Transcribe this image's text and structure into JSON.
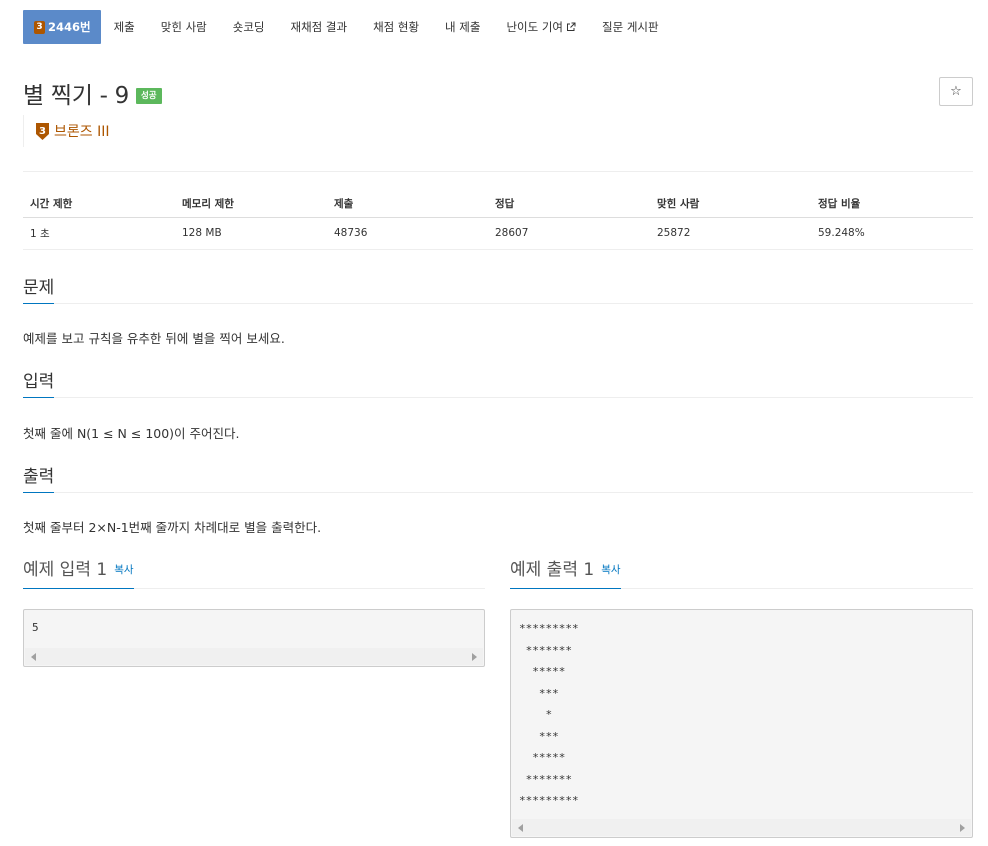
{
  "nav": {
    "problem_tab": {
      "tier_level": "3",
      "label": "2446번"
    },
    "items": [
      {
        "label": "제출"
      },
      {
        "label": "맞힌 사람"
      },
      {
        "label": "숏코딩"
      },
      {
        "label": "재채점 결과"
      },
      {
        "label": "채점 현황"
      },
      {
        "label": "내 제출"
      },
      {
        "label": "난이도 기여"
      },
      {
        "label": "질문 게시판"
      }
    ]
  },
  "problem": {
    "title": "별 찍기 - 9",
    "status_badge": "성공",
    "star_icon": "☆",
    "tier": {
      "level": "3",
      "label": "브론즈 III",
      "color": "#ad5600"
    }
  },
  "info_table": {
    "headers": [
      "시간 제한",
      "메모리 제한",
      "제출",
      "정답",
      "맞힌 사람",
      "정답 비율"
    ],
    "row": [
      "1 초",
      "128 MB",
      "48736",
      "28607",
      "25872",
      "59.248%"
    ]
  },
  "sections": {
    "description": {
      "heading": "문제",
      "text": "예제를 보고 규칙을 유추한 뒤에 별을 찍어 보세요."
    },
    "input": {
      "heading": "입력",
      "text": "첫째 줄에 N(1 ≤ N ≤ 100)이 주어진다."
    },
    "output": {
      "heading": "출력",
      "text": "첫째 줄부터 2×N-1번째 줄까지 차례대로 별을 출력한다."
    }
  },
  "samples": {
    "input": {
      "heading": "예제 입력 1",
      "copy_label": "복사",
      "content": "5"
    },
    "output": {
      "heading": "예제 출력 1",
      "copy_label": "복사",
      "content": "*********\n *******\n  *****\n   ***\n    *\n   ***\n  *****\n *******\n*********"
    }
  },
  "colors": {
    "nav_active": "#5b8ac9",
    "success": "#5cb85c",
    "link": "#0076c0",
    "bronze": "#ad5600"
  }
}
